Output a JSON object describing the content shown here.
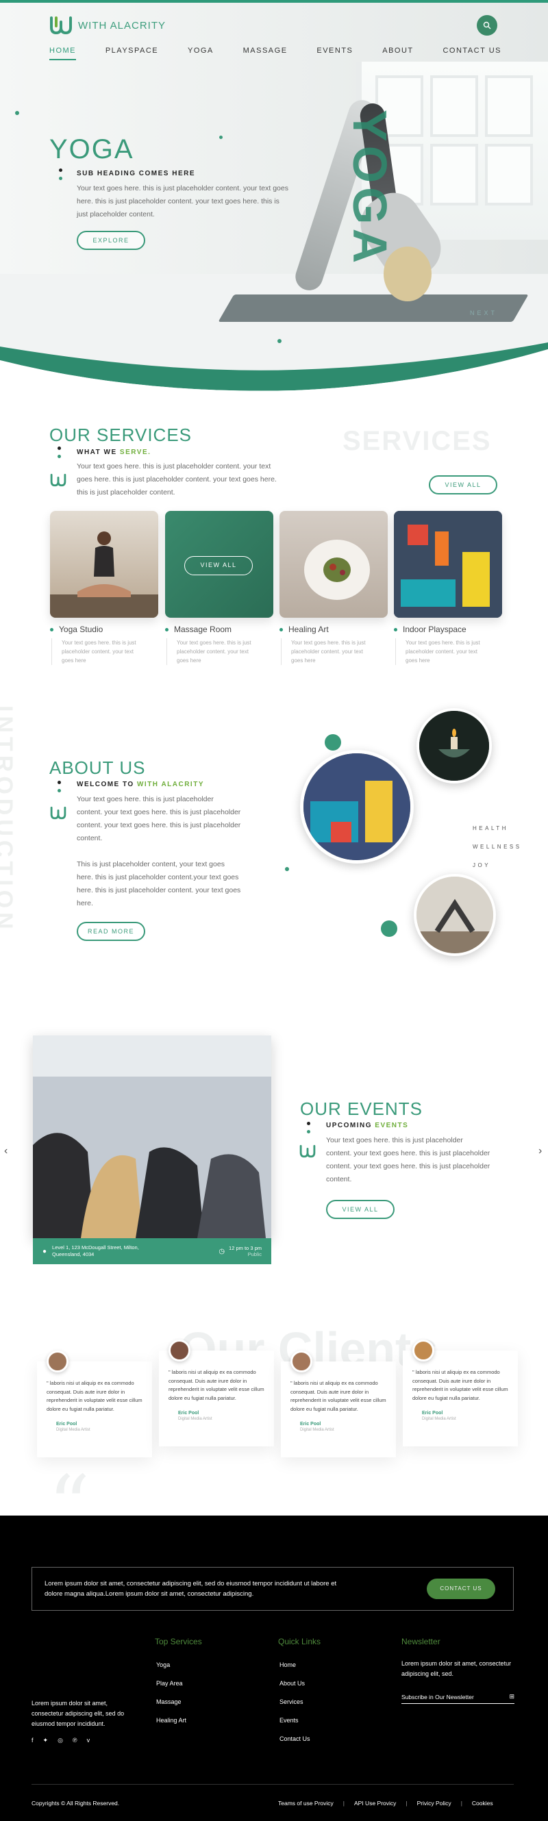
{
  "brand": {
    "name": "WITH ALACRITY"
  },
  "nav": [
    "HOME",
    "PLAYSPACE",
    "YOGA",
    "MASSAGE",
    "EVENTS",
    "ABOUT",
    "CONTACT US"
  ],
  "hero": {
    "title": "YOGA",
    "big_word": "YOGA",
    "subheading": "SUB HEADING COMES HERE",
    "body": "Your text goes here. this is just placeholder content. your text goes here. this is just placeholder content. your text goes here. this is just placeholder content.",
    "button": "EXPLORE",
    "next": "NEXT"
  },
  "services": {
    "ghost": "SERVICES",
    "title": "OUR SERVICES",
    "sub_prefix": "WHAT WE ",
    "sub_accent": "SERVE.",
    "body": "Your text goes here. this is just placeholder content. your text goes here. this is just placeholder content. your text goes here. this is just placeholder content.",
    "button": "VIEW ALL",
    "card_button": "VIEW ALL",
    "cards": [
      {
        "label": "Yoga Studio",
        "desc": "Your text goes here. this is just placeholder content. your text goes here"
      },
      {
        "label": "Massage Room",
        "desc": "Your text goes here. this is just placeholder content. your text goes here"
      },
      {
        "label": "Healing Art",
        "desc": "Your text goes here. this is just placeholder content. your text goes here"
      },
      {
        "label": "Indoor Playspace",
        "desc": "Your text goes here. this is just placeholder content. your text goes here"
      }
    ]
  },
  "about": {
    "ghost": "INTRODUCTION",
    "title": "ABOUT US",
    "sub_prefix": "WELCOME TO ",
    "sub_accent": "WITH ALACRITY",
    "body1": "Your text goes here. this is just placeholder content. your text goes here. this is just placeholder content. your text goes here. this is just placeholder content.",
    "body2": "This is just placeholder content, your text goes here. this is just placeholder content.your text goes here. this is just placeholder content. your text goes here.",
    "button": "READ MORE",
    "words": [
      "HEALTH",
      "WELLNESS",
      "JOY"
    ]
  },
  "events": {
    "title": "OUR EVENTS",
    "sub_prefix": "UPCOMING ",
    "sub_accent": "EVENTS",
    "body": "Your text goes here. this is just placeholder content. your text goes here. this is just placeholder content. your text goes here. this is just placeholder content.",
    "button": "VIEW ALL",
    "location": "Level 1, 123 McDougall Street, Milton, Queensland, 4034",
    "time": "12 pm to 3 pm",
    "time_sub": "Public"
  },
  "clients": {
    "ghost": "Our Clients",
    "items": [
      {
        "quote": "\" laboris nisi ut aliquip ex ea commodo consequat. Duis aute irure dolor in reprehenderit in voluptate velit esse cillum dolore eu fugiat nulla pariatur.",
        "name": "Eric Pool",
        "role": "Digital Media Artist"
      },
      {
        "quote": "\" laboris nisi ut aliquip ex ea commodo consequat. Duis aute irure dolor in reprehenderit in voluptate velit esse cillum dolore eu fugiat nulla pariatur.",
        "name": "Eric Pool",
        "role": "Digital Media Artist"
      },
      {
        "quote": "\" laboris nisi ut aliquip ex ea commodo consequat. Duis aute irure dolor in reprehenderit in voluptate velit esse cillum dolore eu fugiat nulla pariatur.",
        "name": "Eric Pool",
        "role": "Digital Media Artist"
      },
      {
        "quote": "\" laboris nisi ut aliquip ex ea commodo consequat. Duis aute irure dolor in reprehenderit in voluptate velit esse cillum dolore eu fugiat nulla pariatur.",
        "name": "Eric Pool",
        "role": "Digital Media Artist"
      }
    ]
  },
  "footer": {
    "cta_text": "Lorem ipsum dolor sit amet, consectetur adipiscing elit, sed do eiusmod tempor incididunt ut labore et dolore magna aliqua.Lorem ipsum dolor sit amet, consectetur adipiscing.",
    "cta_button": "CONTACT US",
    "about_text": "Lorem ipsum dolor sit amet, consectetur adipiscing elit, sed do eiusmod tempor incididunt.",
    "top_services_title": "Top Services",
    "top_services": [
      "Yoga",
      "Play Area",
      "Massage",
      "Healing Art"
    ],
    "quick_links_title": "Quick Links",
    "quick_links": [
      "Home",
      "About Us",
      "Services",
      "Events",
      "Contact Us"
    ],
    "newsletter_title": "Newsletter",
    "newsletter_text": "Lorem ipsum dolor sit amet, consectetur adipiscing elit, sed.",
    "newsletter_placeholder": "Subscribe in Our Newsletter",
    "copyright": "Copyrights © All Rights Reserved.",
    "legal": [
      "Teams of use Provicy",
      "API Use Provicy",
      "Privicy Policy",
      "Cookies"
    ]
  },
  "colors": {
    "accent": "#3a9a7a",
    "lime": "#6fae3b",
    "footer_bg": "#000000"
  }
}
